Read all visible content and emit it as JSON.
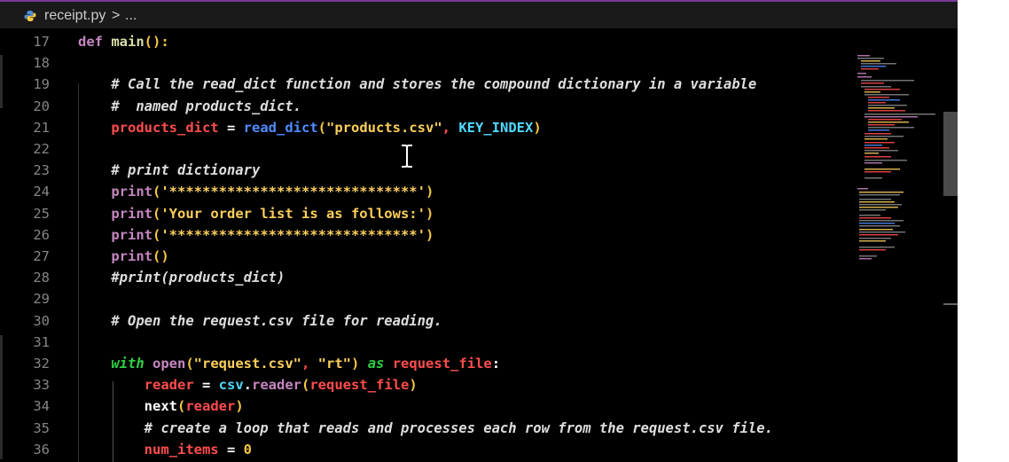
{
  "breadcrumb": {
    "file": "receipt.py",
    "chevron": ">",
    "more": "..."
  },
  "lines": [
    {
      "n": "17",
      "tokens": [
        [
          "def",
          "def"
        ],
        [
          "fn",
          " main"
        ],
        [
          "prn",
          "():"
        ]
      ]
    },
    {
      "n": "18",
      "tokens": []
    },
    {
      "n": "19",
      "tokens": [
        [
          "cmt",
          "    # Call the read_dict function and stores the compound dictionary in a variable"
        ]
      ]
    },
    {
      "n": "20",
      "tokens": [
        [
          "cmt",
          "    #  named products_dict."
        ]
      ]
    },
    {
      "n": "21",
      "tokens": [
        [
          "pln",
          "    "
        ],
        [
          "var",
          "products_dict"
        ],
        [
          "pln",
          " = "
        ],
        [
          "call",
          "read_dict"
        ],
        [
          "prn",
          "("
        ],
        [
          "str",
          "\"products.csv\""
        ],
        [
          "var",
          ", "
        ],
        [
          "const",
          "KEY_INDEX"
        ],
        [
          "prn",
          ")"
        ]
      ]
    },
    {
      "n": "22",
      "tokens": []
    },
    {
      "n": "23",
      "tokens": [
        [
          "cmt",
          "    # print dictionary"
        ]
      ]
    },
    {
      "n": "24",
      "tokens": [
        [
          "pln",
          "    "
        ],
        [
          "kw",
          "print"
        ],
        [
          "prn",
          "("
        ],
        [
          "str",
          "'******************************'"
        ],
        [
          "prn",
          ")"
        ]
      ]
    },
    {
      "n": "25",
      "tokens": [
        [
          "pln",
          "    "
        ],
        [
          "kw",
          "print"
        ],
        [
          "prn",
          "("
        ],
        [
          "str",
          "'Your order list is as follows:'"
        ],
        [
          "prn",
          ")"
        ]
      ]
    },
    {
      "n": "26",
      "tokens": [
        [
          "pln",
          "    "
        ],
        [
          "kw",
          "print"
        ],
        [
          "prn",
          "("
        ],
        [
          "str",
          "'******************************'"
        ],
        [
          "prn",
          ")"
        ]
      ]
    },
    {
      "n": "27",
      "tokens": [
        [
          "pln",
          "    "
        ],
        [
          "kw",
          "print"
        ],
        [
          "prn",
          "()"
        ]
      ]
    },
    {
      "n": "28",
      "tokens": [
        [
          "cmt",
          "    #print(products_dict)"
        ]
      ]
    },
    {
      "n": "29",
      "tokens": []
    },
    {
      "n": "30",
      "tokens": [
        [
          "cmt",
          "    # Open the request.csv file for reading."
        ]
      ]
    },
    {
      "n": "31",
      "tokens": []
    },
    {
      "n": "32",
      "tokens": [
        [
          "pln",
          "    "
        ],
        [
          "with",
          "with"
        ],
        [
          "pln",
          " "
        ],
        [
          "kw",
          "open"
        ],
        [
          "prn",
          "("
        ],
        [
          "str",
          "\"request.csv\""
        ],
        [
          "var",
          ", "
        ],
        [
          "str",
          "\"rt\""
        ],
        [
          "prn",
          ")"
        ],
        [
          "pln",
          " "
        ],
        [
          "with",
          "as"
        ],
        [
          "pln",
          " "
        ],
        [
          "var",
          "request_file"
        ],
        [
          "pln",
          ":"
        ]
      ]
    },
    {
      "n": "33",
      "tokens": [
        [
          "pln",
          "        "
        ],
        [
          "var",
          "reader"
        ],
        [
          "pln",
          " = "
        ],
        [
          "const",
          "csv"
        ],
        [
          "pln",
          "."
        ],
        [
          "kw",
          "reader"
        ],
        [
          "prn",
          "("
        ],
        [
          "var",
          "request_file"
        ],
        [
          "prn",
          ")"
        ]
      ]
    },
    {
      "n": "34",
      "tokens": [
        [
          "pln",
          "        next"
        ],
        [
          "prn",
          "("
        ],
        [
          "var",
          "reader"
        ],
        [
          "prn",
          ")"
        ]
      ]
    },
    {
      "n": "35",
      "tokens": [
        [
          "cmt",
          "        # create a loop that reads and processes each row from the request.csv file."
        ]
      ]
    },
    {
      "n": "36",
      "tokens": [
        [
          "pln",
          "        "
        ],
        [
          "var",
          "num_items"
        ],
        [
          "pln",
          " = "
        ],
        [
          "num",
          "0"
        ]
      ]
    }
  ],
  "colors": {
    "def": "#c586c0",
    "kw": "#c586c0",
    "fn": "#dcdcaa",
    "cmt": "#dddddd",
    "var": "#ff4d4d",
    "call": "#4f8dff",
    "str": "#fbcf5a",
    "const": "#4fd9ff",
    "pln": "#ffffff",
    "prn": "#f5c842",
    "num": "#f5c842",
    "with": "#2ecc40"
  }
}
